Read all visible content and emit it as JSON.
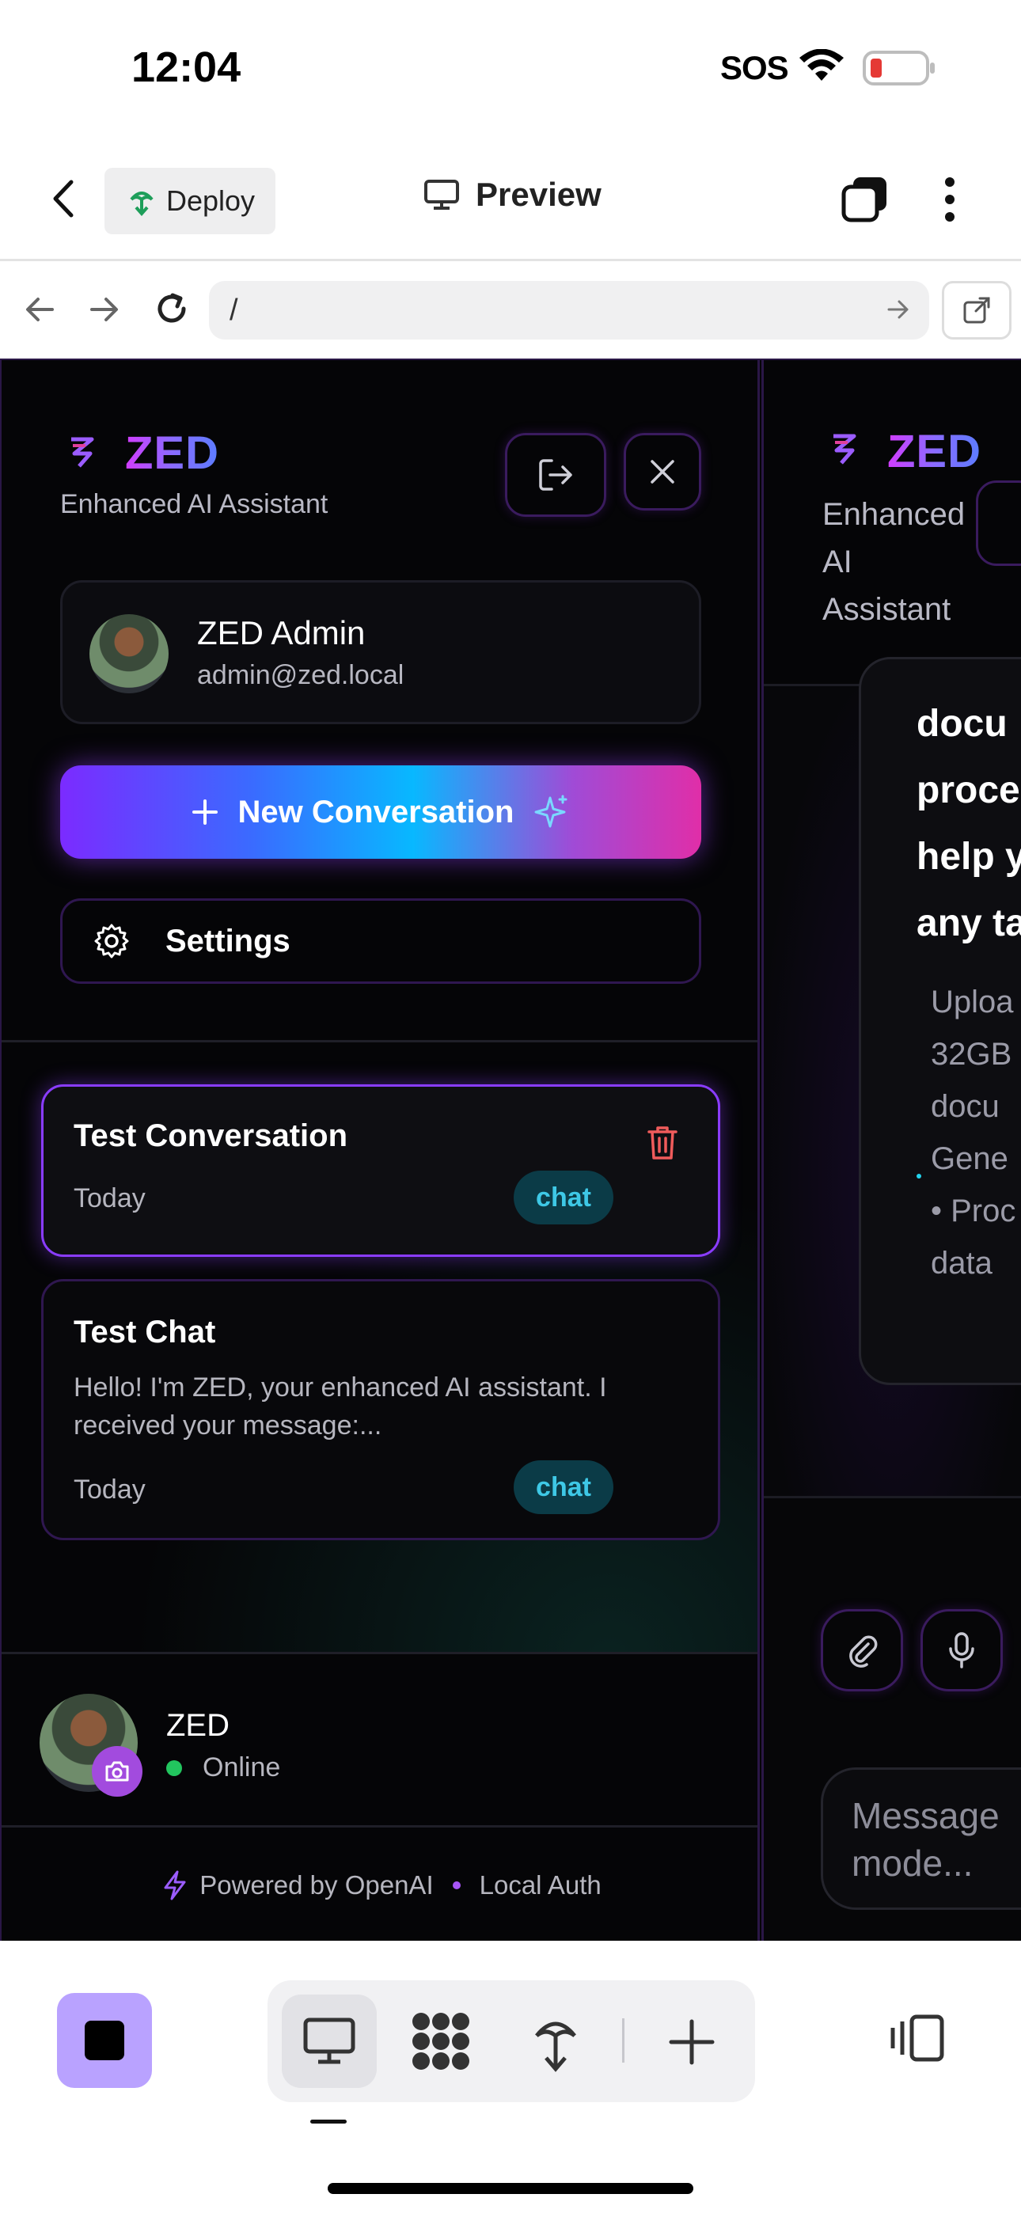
{
  "status": {
    "time": "12:04",
    "sos": "SOS"
  },
  "topbar": {
    "deploy_label": "Deploy",
    "preview_label": "Preview"
  },
  "browser": {
    "url": "/"
  },
  "sidebar": {
    "brand": "ZED",
    "tagline": "Enhanced AI Assistant",
    "user": {
      "name": "ZED Admin",
      "email": "admin@zed.local"
    },
    "new_conversation_label": "New Conversation",
    "settings_label": "Settings",
    "conversations": [
      {
        "title": "Test Conversation",
        "preview": "",
        "date": "Today",
        "tag": "chat",
        "active": true
      },
      {
        "title": "Test Chat",
        "preview": "Hello! I'm ZED, your enhanced AI assistant. I received your message:...",
        "date": "Today",
        "tag": "chat",
        "active": false
      }
    ],
    "footer_user": {
      "name": "ZED",
      "status": "Online"
    },
    "powered_by": "Powered by OpenAI",
    "auth": "Local Auth"
  },
  "right_panel": {
    "brand": "ZED",
    "tagline_lines": [
      "Enhanced",
      "AI",
      "Assistant"
    ],
    "message_lines": [
      "docu",
      "proce",
      "help y",
      "any ta"
    ],
    "sub_lines": [
      "Uploa",
      "32GB",
      "docu",
      "Gene",
      "• Proc",
      "data"
    ],
    "input_placeholder_lines": [
      "Message",
      "mode..."
    ]
  },
  "colors": {
    "accent_purple": "#a855f7",
    "cyan": "#22d3ee",
    "pink": "#e23fb3",
    "online": "#22c55e",
    "delete": "#ef4444"
  }
}
